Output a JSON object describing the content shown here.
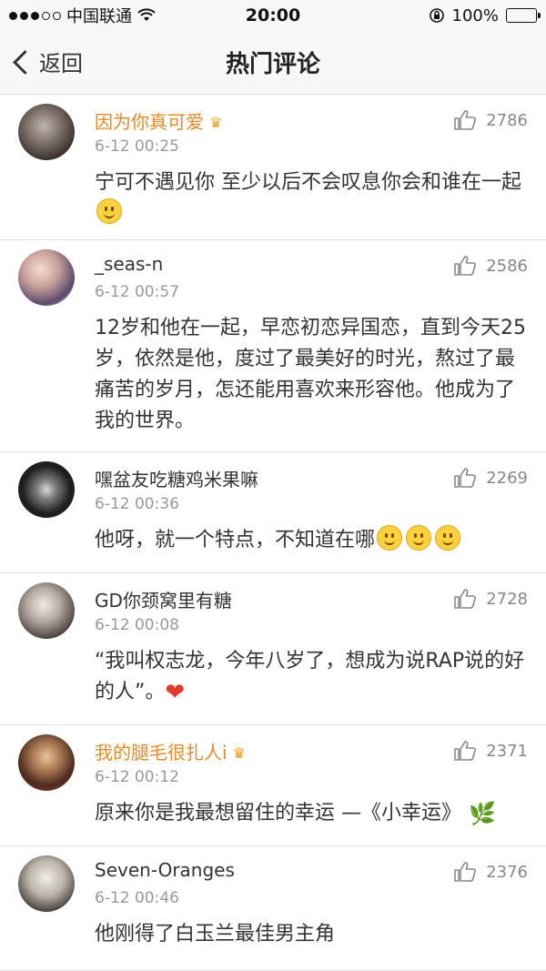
{
  "status_bar": {
    "carrier": "中国联通",
    "time": "20:00",
    "battery": "100%",
    "wifi_icon": "wifi-icon",
    "lock_icon": "orientation-lock-icon"
  },
  "nav": {
    "back_label": "返回",
    "title": "热门评论"
  },
  "comments": [
    {
      "username": "因为你真可爱",
      "vip": true,
      "time": "6-12 00:25",
      "likes": "2786",
      "text": "宁可不遇见你 至少以后不会叹息你会和谁在一起",
      "trailing": "smile"
    },
    {
      "username": "_seas-n",
      "vip": false,
      "time": "6-12 00:57",
      "likes": "2586",
      "text": "12岁和他在一起，早恋初恋异国恋，直到今天25岁，依然是他，度过了最美好的时光，熬过了最痛苦的岁月，怎还能用喜欢来形容他。他成为了我的世界。",
      "trailing": ""
    },
    {
      "username": "嘿盆友吃糖鸡米果嘛",
      "vip": false,
      "time": "6-12 00:36",
      "likes": "2269",
      "text": "他呀，就一个特点，不知道在哪",
      "trailing": "smile3"
    },
    {
      "username": "GD你颈窝里有糖",
      "vip": false,
      "time": "6-12 00:08",
      "likes": "2728",
      "text": "“我叫权志龙，今年八岁了，想成为说RAP说的好的人”。",
      "trailing": "heart"
    },
    {
      "username": "我的腿毛很扎人i",
      "vip": true,
      "time": "6-12 00:12",
      "likes": "2371",
      "text": "原来你是我最想留住的幸运 —《小幸运》",
      "trailing": "leaf"
    },
    {
      "username": "Seven-Oranges",
      "vip": false,
      "time": "6-12 00:46",
      "likes": "2376",
      "text": "他刚得了白玉兰最佳男主角",
      "trailing": ""
    }
  ]
}
